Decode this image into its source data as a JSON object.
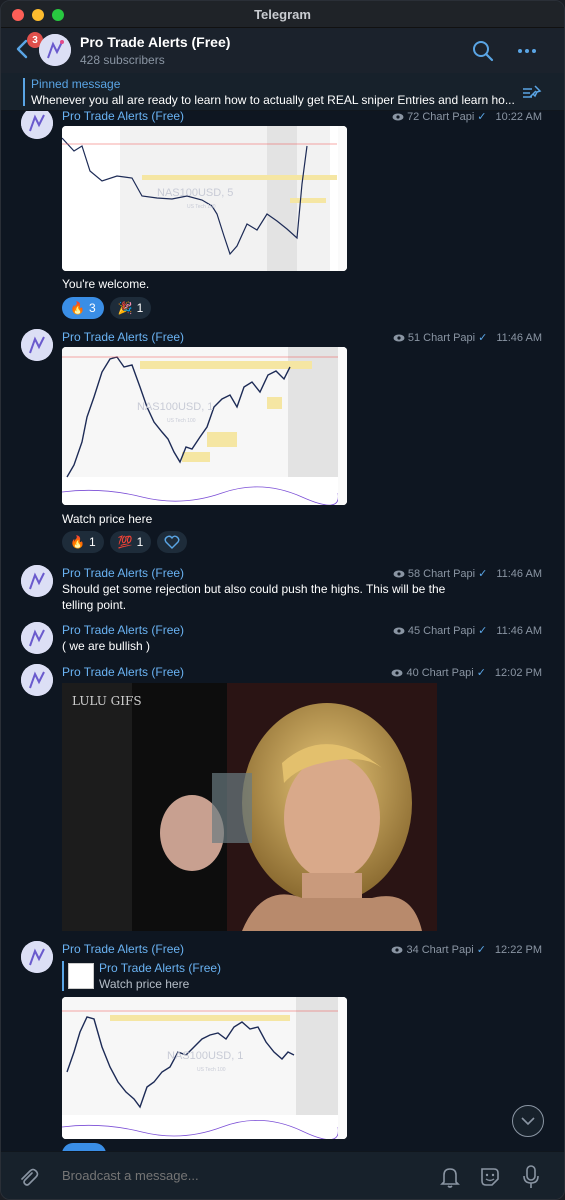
{
  "window": {
    "title": "Telegram"
  },
  "header": {
    "unread_badge": "3",
    "channel_name": "Pro Trade Alerts (Free)",
    "subscribers": "428 subscribers"
  },
  "pinned": {
    "label": "Pinned message",
    "text": "Whenever you all are ready to learn how to actually get REAL sniper Entries and learn ho..."
  },
  "messages": [
    {
      "sender": "Pro Trade Alerts (Free)",
      "views": "72",
      "author": "Chart Papi",
      "time": "10:22 AM",
      "chart_watermark": "NAS100USD, 5",
      "chart_watermark_sub": "US Tech 100",
      "text": "You're welcome.",
      "reactions": [
        {
          "emoji": "🔥",
          "count": "3"
        },
        {
          "emoji": "🎉",
          "count": "1"
        }
      ]
    },
    {
      "sender": "Pro Trade Alerts (Free)",
      "views": "51",
      "author": "Chart Papi",
      "time": "11:46 AM",
      "chart_watermark": "NAS100USD, 1",
      "chart_watermark_sub": "US Tech 100",
      "text": "Watch price here",
      "reactions": [
        {
          "emoji": "🔥",
          "count": "1"
        },
        {
          "emoji": "💯",
          "count": "1"
        }
      ]
    },
    {
      "sender": "Pro Trade Alerts (Free)",
      "views": "58",
      "author": "Chart Papi",
      "time": "11:46 AM",
      "text": "Should get some rejection but also could push the highs. This will be the telling point."
    },
    {
      "sender": "Pro Trade Alerts (Free)",
      "views": "45",
      "author": "Chart Papi",
      "time": "11:46 AM",
      "text": "( we are bullish )"
    },
    {
      "sender": "Pro Trade Alerts (Free)",
      "views": "40",
      "author": "Chart Papi",
      "time": "12:02 PM",
      "gif_watermark": "LULU GIFS"
    },
    {
      "sender": "Pro Trade Alerts (Free)",
      "views": "34",
      "author": "Chart Papi",
      "time": "12:22 PM",
      "reply_name": "Pro Trade Alerts (Free)",
      "reply_text": "Watch price here",
      "chart_watermark": "NAS100USD, 1",
      "chart_watermark_sub": "US Tech 100"
    }
  ],
  "composer": {
    "placeholder": "Broadcast a message..."
  },
  "icons": {
    "back": "chevron-left-icon",
    "search": "search-icon",
    "more": "more-icon",
    "pin": "pin-list-icon",
    "attach": "paperclip-icon",
    "bell": "bell-icon",
    "sticker": "sticker-icon",
    "mic": "microphone-icon",
    "scroll": "chevron-down-icon"
  },
  "colors": {
    "accent": "#5aa5e5",
    "link": "#6ab3f3",
    "badge": "#e0504c",
    "bg": "#0e1621"
  }
}
